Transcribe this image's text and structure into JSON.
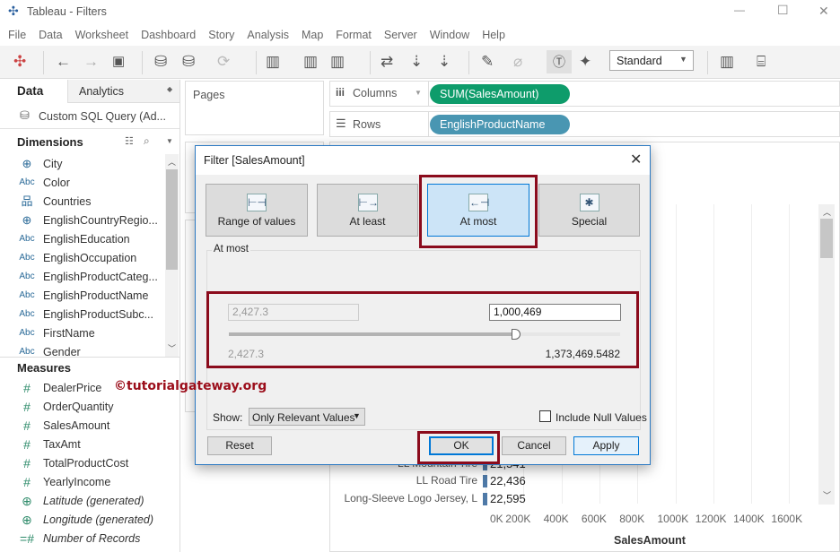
{
  "window": {
    "title": "Tableau - Filters",
    "minimize": "—",
    "maximize": "☐",
    "close": "✕"
  },
  "menu": [
    "File",
    "Data",
    "Worksheet",
    "Dashboard",
    "Story",
    "Analysis",
    "Map",
    "Format",
    "Server",
    "Window",
    "Help"
  ],
  "toolbar": {
    "fit_select": "Standard"
  },
  "left_panel": {
    "tabs": [
      "Data",
      "Analytics"
    ],
    "datasource": "Custom SQL Query (Ad...",
    "dimensions_title": "Dimensions",
    "dimensions": [
      {
        "icon": "globe",
        "type": "⊕",
        "label": "City"
      },
      {
        "icon": "abc",
        "type": "Abc",
        "label": "Color"
      },
      {
        "icon": "hierarchy",
        "type": "品",
        "label": "Countries"
      },
      {
        "icon": "globe",
        "type": "⊕",
        "label": "EnglishCountryRegio..."
      },
      {
        "icon": "abc",
        "type": "Abc",
        "label": "EnglishEducation"
      },
      {
        "icon": "abc",
        "type": "Abc",
        "label": "EnglishOccupation"
      },
      {
        "icon": "abc",
        "type": "Abc",
        "label": "EnglishProductCateg..."
      },
      {
        "icon": "abc",
        "type": "Abc",
        "label": "EnglishProductName"
      },
      {
        "icon": "abc",
        "type": "Abc",
        "label": "EnglishProductSubc..."
      },
      {
        "icon": "abc",
        "type": "Abc",
        "label": "FirstName"
      },
      {
        "icon": "abc",
        "type": "Abc",
        "label": "Gender"
      }
    ],
    "measures_title": "Measures",
    "measures": [
      {
        "type": "#",
        "label": "DealerPrice"
      },
      {
        "type": "#",
        "label": "OrderQuantity"
      },
      {
        "type": "#",
        "label": "SalesAmount"
      },
      {
        "type": "#",
        "label": "TaxAmt"
      },
      {
        "type": "#",
        "label": "TotalProductCost"
      },
      {
        "type": "#",
        "label": "YearlyIncome"
      },
      {
        "type": "⊕",
        "label": "Latitude (generated)"
      },
      {
        "type": "⊕",
        "label": "Longitude (generated)"
      },
      {
        "type": "=#",
        "label": "Number of Records"
      }
    ]
  },
  "pages_label": "Pages",
  "shelves": {
    "columns_label": "Columns",
    "columns_pill": "SUM(SalesAmount)",
    "rows_label": "Rows",
    "rows_pill": "EnglishProductName",
    "columns_color": "#0e9c6b",
    "rows_color": "#4996b2"
  },
  "watermark": "©tutorialgateway.org",
  "dialog": {
    "title": "Filter [SalesAmount]",
    "modes": [
      "Range of values",
      "At least",
      "At most",
      "Special"
    ],
    "selected_mode": "At most",
    "group_label": "At most",
    "min_value": "2,427.3",
    "max_value": "1,000,469",
    "range_min": "2,427.3",
    "range_max": "1,373,469.5482",
    "slider_fraction": 0.73,
    "show_label": "Show:",
    "show_value": "Only Relevant Values",
    "include_null_label": "Include Null Values",
    "include_null": false,
    "buttons": {
      "reset": "Reset",
      "ok": "OK",
      "cancel": "Cancel",
      "apply": "Apply"
    }
  },
  "chart_data": {
    "type": "bar",
    "categories": [
      "LL Mountain Tire",
      "LL Road Tire",
      "Long-Sleeve Logo Jersey, L"
    ],
    "values": [
      21541,
      22436,
      22595
    ],
    "value_labels": [
      "21,541",
      "22,436",
      "22,595"
    ],
    "xlabel": "SalesAmount",
    "xticks": [
      "0K",
      "200K",
      "400K",
      "600K",
      "800K",
      "1000K",
      "1200K",
      "1400K",
      "1600K"
    ],
    "xlim": [
      0,
      1700000
    ]
  }
}
